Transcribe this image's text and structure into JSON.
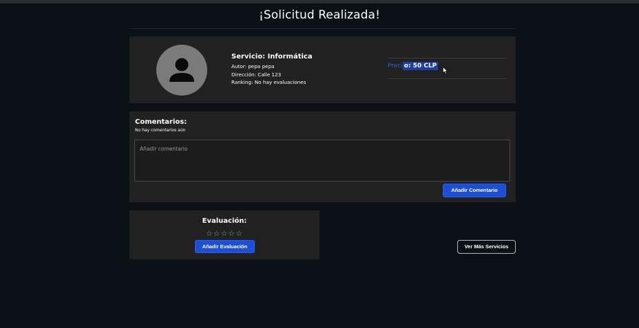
{
  "page": {
    "title": "¡Solicitud Realizada!"
  },
  "service": {
    "title": "Servicio: Informática",
    "author": "Autor: pepa pepa",
    "address": "Dirección: Calle 123",
    "ranking": "Ranking: No hay evaluaciones",
    "price_prefix": "Preci",
    "price_selected": "o: 50 CLP",
    "avatar_icon": "user-icon"
  },
  "comments": {
    "title": "Comentarios:",
    "empty_text": "No hay comentarios aún",
    "placeholder": "Añadir comentario",
    "add_button": "Añadir Comentario"
  },
  "evaluation": {
    "title": "Evaluación:",
    "stars": "☆☆☆☆☆",
    "rating": 0,
    "max_rating": 5,
    "add_button": "Añadir Evaluación"
  },
  "actions": {
    "more_services": "Ver Más Servicios"
  },
  "colors": {
    "background": "#0b1116",
    "card": "#212121",
    "accent": "#1c4fd6",
    "selection": "#1d3fa3"
  }
}
